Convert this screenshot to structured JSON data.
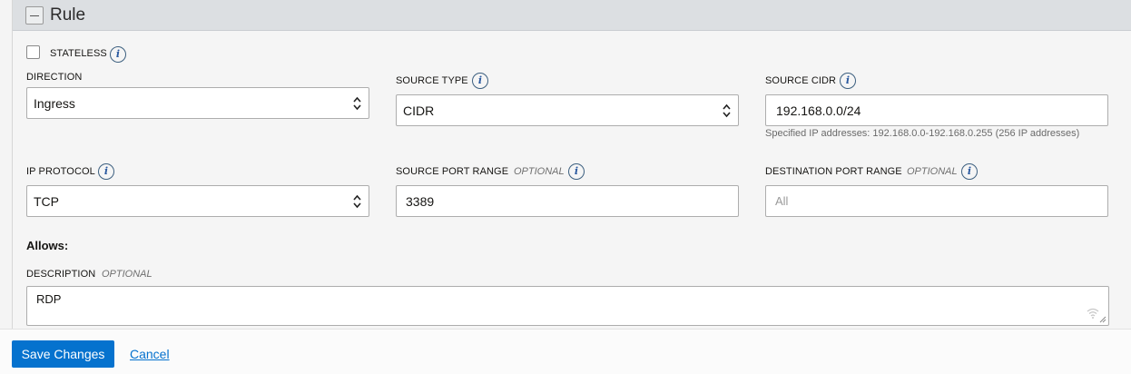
{
  "panel": {
    "title": "Rule"
  },
  "stateless": {
    "label": "STATELESS",
    "checked": false
  },
  "direction": {
    "label": "DIRECTION",
    "value": "Ingress"
  },
  "source_type": {
    "label": "SOURCE TYPE",
    "value": "CIDR"
  },
  "source_cidr": {
    "label": "SOURCE CIDR",
    "value": "192.168.0.0/24",
    "hint": "Specified IP addresses: 192.168.0.0-192.168.0.255 (256 IP addresses)"
  },
  "ip_protocol": {
    "label": "IP PROTOCOL",
    "value": "TCP"
  },
  "source_port_range": {
    "label": "SOURCE PORT RANGE",
    "optional": "OPTIONAL",
    "value": "3389"
  },
  "destination_port_range": {
    "label": "DESTINATION PORT RANGE",
    "optional": "OPTIONAL",
    "placeholder": "All"
  },
  "allows": {
    "label": "Allows:"
  },
  "description": {
    "label": "DESCRIPTION",
    "optional": "OPTIONAL",
    "value": "RDP"
  },
  "footer": {
    "save_label": "Save Changes",
    "cancel_label": "Cancel"
  },
  "colors": {
    "primary": "#0572ce",
    "info_icon": "#2b5aa0",
    "header_bg": "#dcdfe2"
  },
  "icons": {
    "info": "info-icon",
    "collapse": "minus-icon",
    "select": "chevron-updown-icon"
  }
}
